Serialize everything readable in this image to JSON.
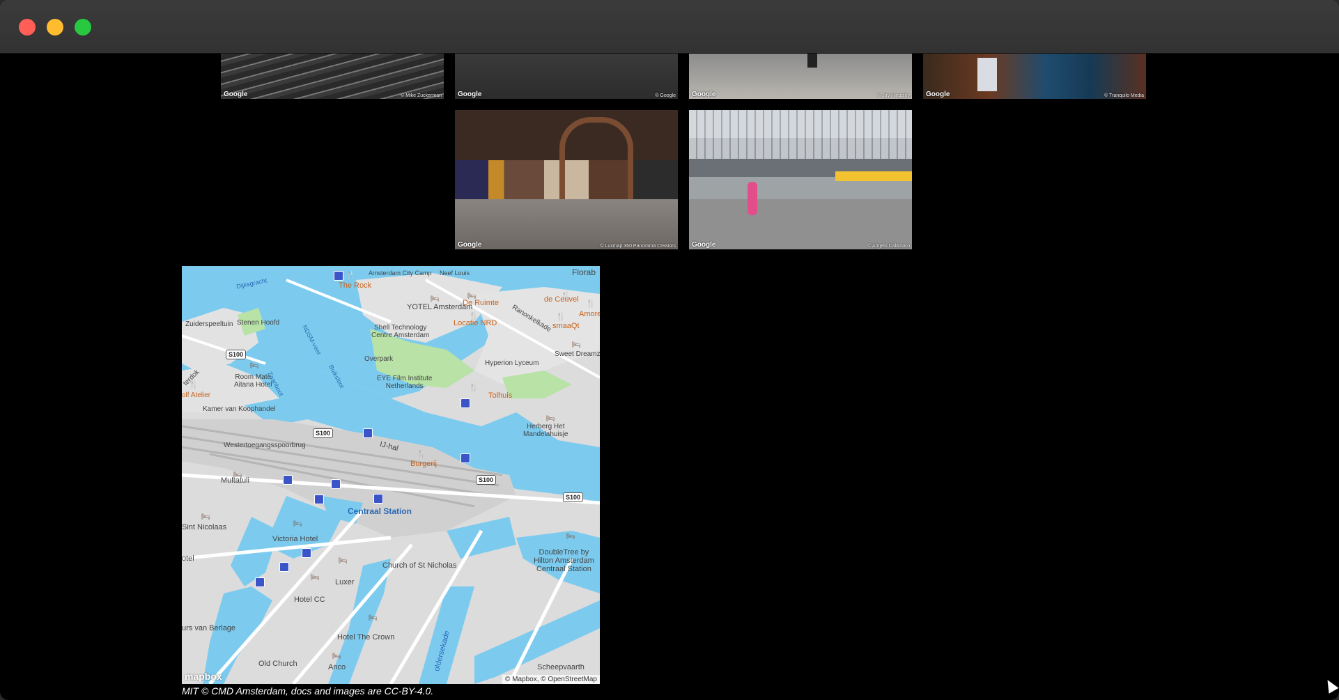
{
  "window": {
    "controls": [
      "close-button",
      "minimize-button",
      "zoom-button"
    ]
  },
  "thumbnails": [
    {
      "watermark": "Google",
      "credit": "© Mike Zuckerman"
    },
    {
      "watermark": "Google",
      "credit": "© Google"
    },
    {
      "watermark": "Google",
      "credit": "© Jay Hingsley"
    },
    {
      "watermark": "Google",
      "credit": "© Tranquilo Media"
    },
    {
      "watermark": "Google",
      "credit": "© Luxmap 360 Panorama Creators"
    },
    {
      "watermark": "Google",
      "credit": "© Angelo Calamaro"
    }
  ],
  "map": {
    "logo": "mapbox",
    "attribution": "© Mapbox, © OpenStreetMap",
    "labels": {
      "amsterdam_city_camp": "Amsterdam City Camp",
      "neef_louis": "Neef Louis",
      "florab": "Florab",
      "the_rock": "The Rock",
      "de_ceuvel": "de Ceuvel",
      "yotel": "YOTEL Amsterdam",
      "de_ruimte": "De Ruimte",
      "locatie_nrd": "Locatie NRD",
      "smaaQt": "smaaQt",
      "amore": "Amore",
      "ranonkelkade": "Ranonkelkade",
      "zuiderspeeltuin": "Zuiderspeeltuin",
      "stenen_hoofd": "Stenen Hoofd",
      "shell_tech": "Shell Technology\nCentre Amsterdam",
      "sweet_dreamz": "Sweet Dreamz",
      "hyperion": "Hyperion Lyceum",
      "overpark": "Overpark",
      "eye": "EYE Film Institute\nNetherlands",
      "room_mate": "Room Mate\nAitana Hotel",
      "olf_atelier": "olf Atelier",
      "tolhuis": "Tolhuis",
      "kamer": "Kamer van Koophandel",
      "herberg": "Herberg Het\nMandelahuisje",
      "wester": "Westertoegangsspoorbrug",
      "ij_hal": "IJ-hal",
      "burgerij": "Burgerij",
      "multatuli": "Multatuli",
      "centraal": "Centraal Station",
      "sint_nicolaas": "Sint Nicolaas",
      "victoria": "Victoria Hotel",
      "doubletree": "DoubleTree by\nHilton Amsterdam\nCentraal Station",
      "otel": "otel",
      "church_st_nicholas": "Church of St Nicholas",
      "luxer": "Luxer",
      "hotel_cc": "Hotel CC",
      "beurs": "urs van Berlage",
      "hotel_crown": "Hotel The Crown",
      "old_church": "Old Church",
      "anco": "Anco",
      "scheepvaart": "Scheepvaarth",
      "oldersekade": "oldersekade",
      "terdok": "terdok",
      "s100_a": "S100",
      "s100_b": "S100",
      "s100_c": "S100",
      "s100_d": "S100",
      "dijksgracht": "Dijksgracht",
      "ndsm_veer": "NDSM-veer",
      "buiksloot": "Buiksloot",
      "zaanboot": "Zaanboot"
    }
  },
  "footer": {
    "text": "MIT © CMD Amsterdam, docs and images are CC-BY-4.0."
  }
}
